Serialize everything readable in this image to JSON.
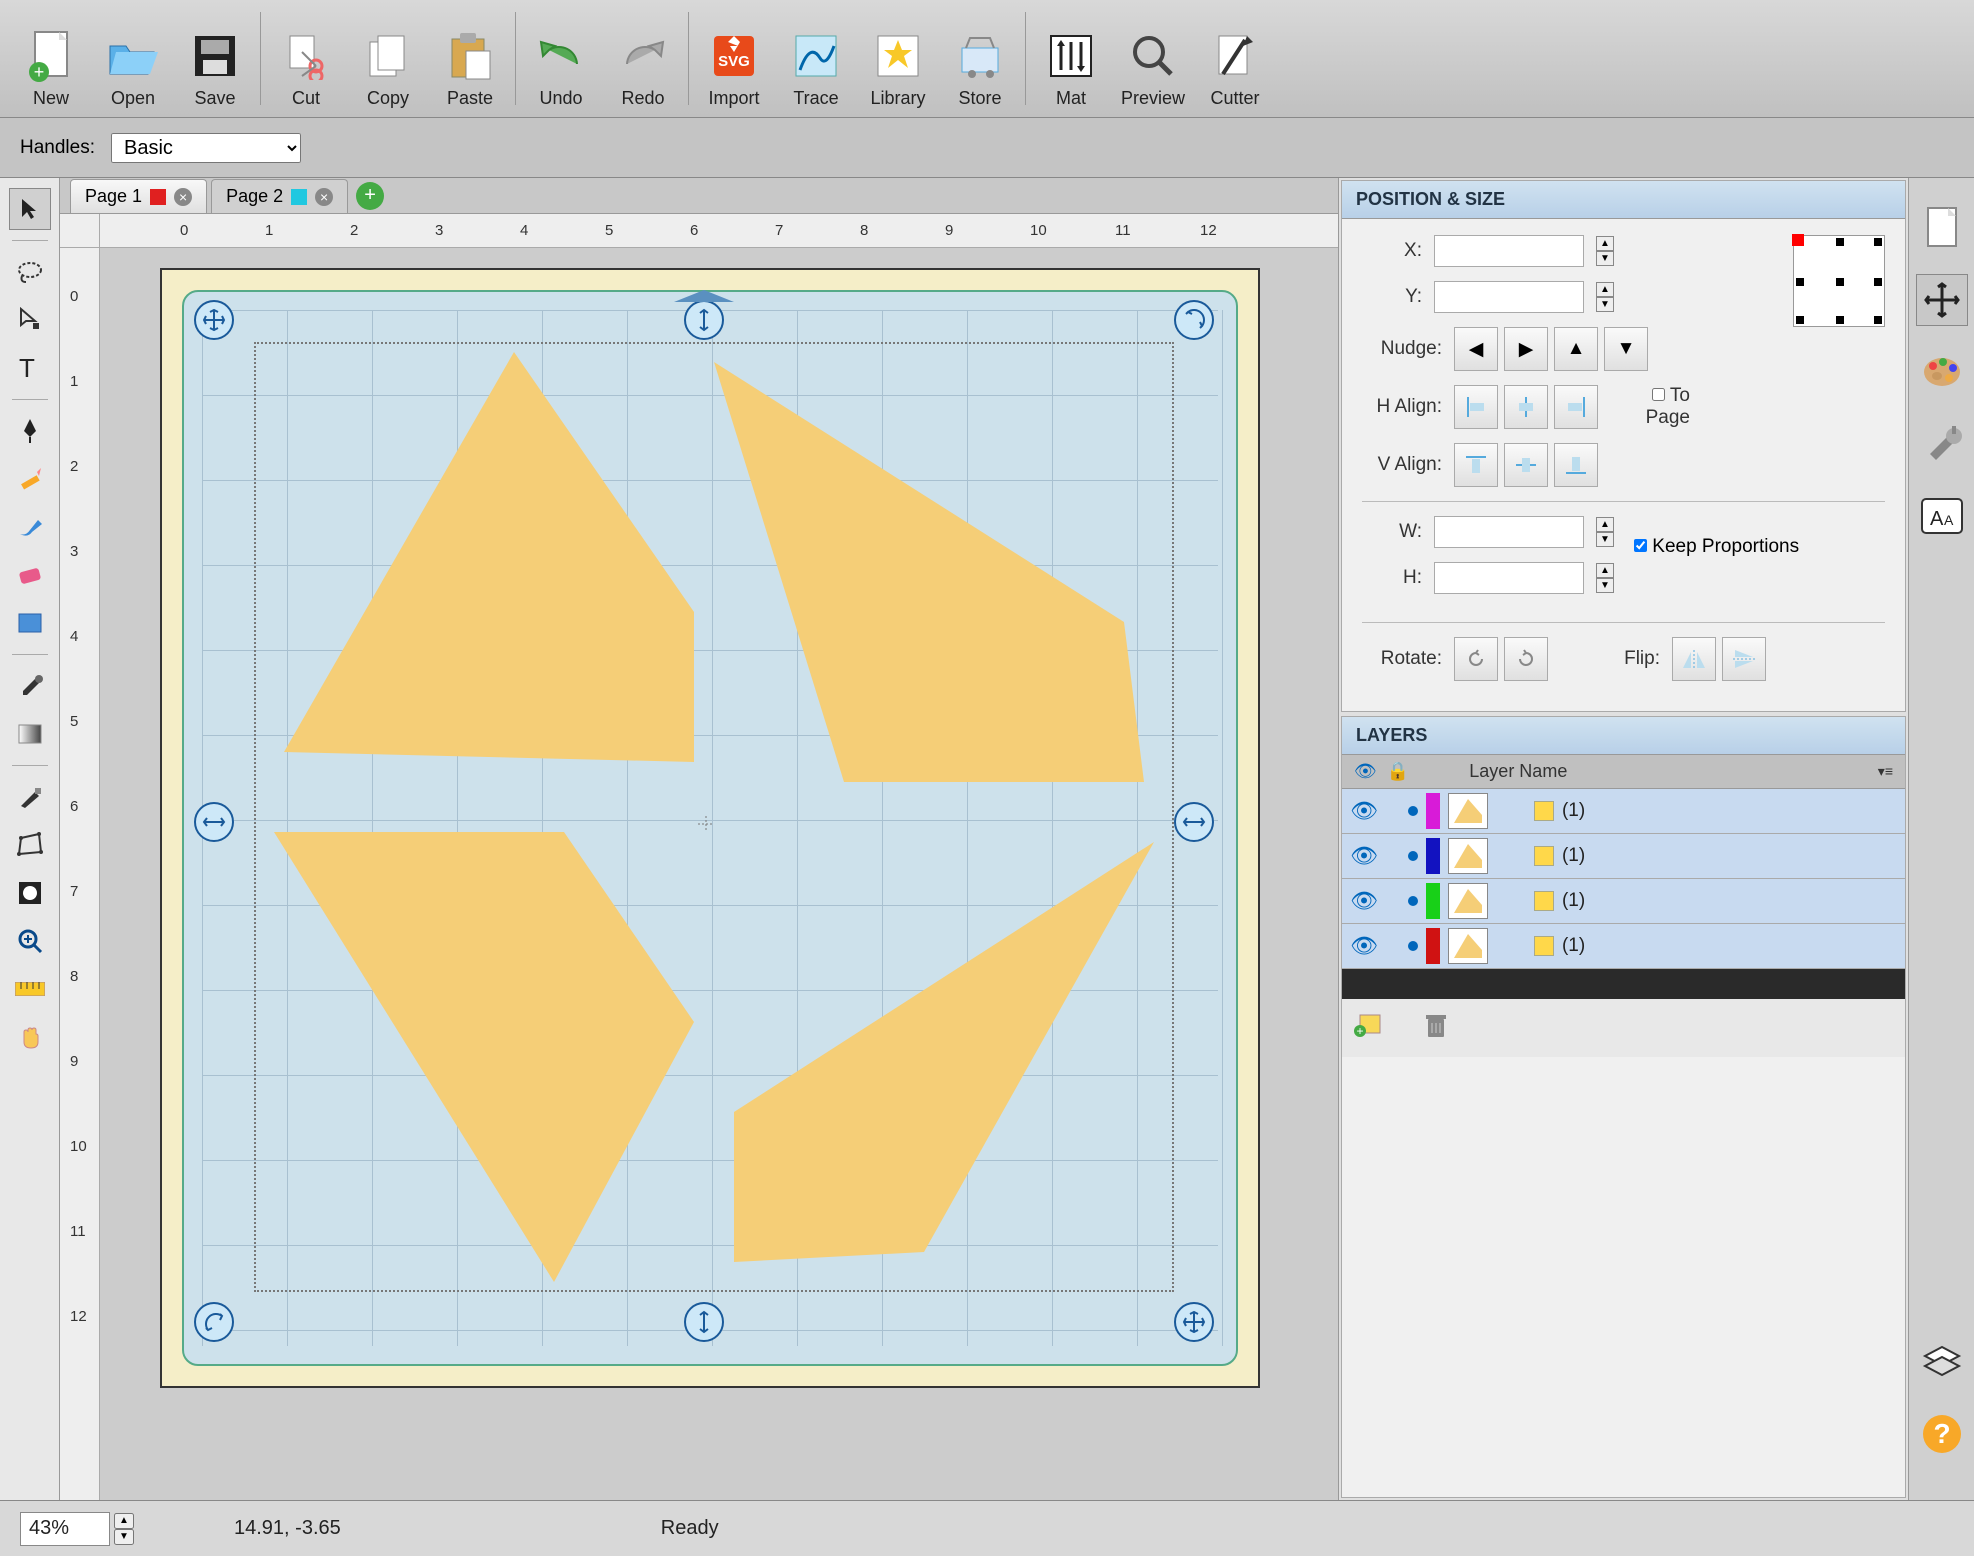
{
  "toolbar": [
    {
      "id": "new",
      "label": "New"
    },
    {
      "id": "open",
      "label": "Open"
    },
    {
      "id": "save",
      "label": "Save"
    },
    {
      "sep": true
    },
    {
      "id": "cut",
      "label": "Cut"
    },
    {
      "id": "copy",
      "label": "Copy"
    },
    {
      "id": "paste",
      "label": "Paste"
    },
    {
      "sep": true
    },
    {
      "id": "undo",
      "label": "Undo"
    },
    {
      "id": "redo",
      "label": "Redo"
    },
    {
      "sep": true
    },
    {
      "id": "import",
      "label": "Import"
    },
    {
      "id": "trace",
      "label": "Trace"
    },
    {
      "id": "library",
      "label": "Library"
    },
    {
      "id": "store",
      "label": "Store"
    },
    {
      "sep": true
    },
    {
      "id": "mat",
      "label": "Mat"
    },
    {
      "id": "preview",
      "label": "Preview"
    },
    {
      "id": "cutter",
      "label": "Cutter"
    }
  ],
  "handles": {
    "label": "Handles:",
    "value": "Basic"
  },
  "tabs": [
    {
      "label": "Page 1",
      "color": "#e02020",
      "active": true
    },
    {
      "label": "Page 2",
      "color": "#20c8e0",
      "active": false
    }
  ],
  "ruler_ticks": [
    "0",
    "1",
    "2",
    "3",
    "4",
    "5",
    "6",
    "7",
    "8",
    "9",
    "10",
    "11",
    "12"
  ],
  "panels": {
    "position": {
      "title": "POSITION & SIZE",
      "x_label": "X:",
      "x_value": "",
      "y_label": "Y:",
      "y_value": "",
      "nudge_label": "Nudge:",
      "halign_label": "H Align:",
      "valign_label": "V Align:",
      "to_page_label": "To Page",
      "w_label": "W:",
      "w_value": "",
      "h_label": "H:",
      "h_value": "",
      "keep_prop_label": "Keep Proportions",
      "keep_prop_checked": true,
      "rotate_label": "Rotate:",
      "flip_label": "Flip:"
    },
    "layers": {
      "title": "LAYERS",
      "header": "Layer Name",
      "items": [
        {
          "color": "#d81bd8",
          "name": "(1)"
        },
        {
          "color": "#1212c0",
          "name": "(1)"
        },
        {
          "color": "#18d018",
          "name": "(1)"
        },
        {
          "color": "#d01212",
          "name": "(1)"
        }
      ]
    }
  },
  "status": {
    "zoom": "43%",
    "coords": "14.91, -3.65",
    "state": "Ready"
  }
}
